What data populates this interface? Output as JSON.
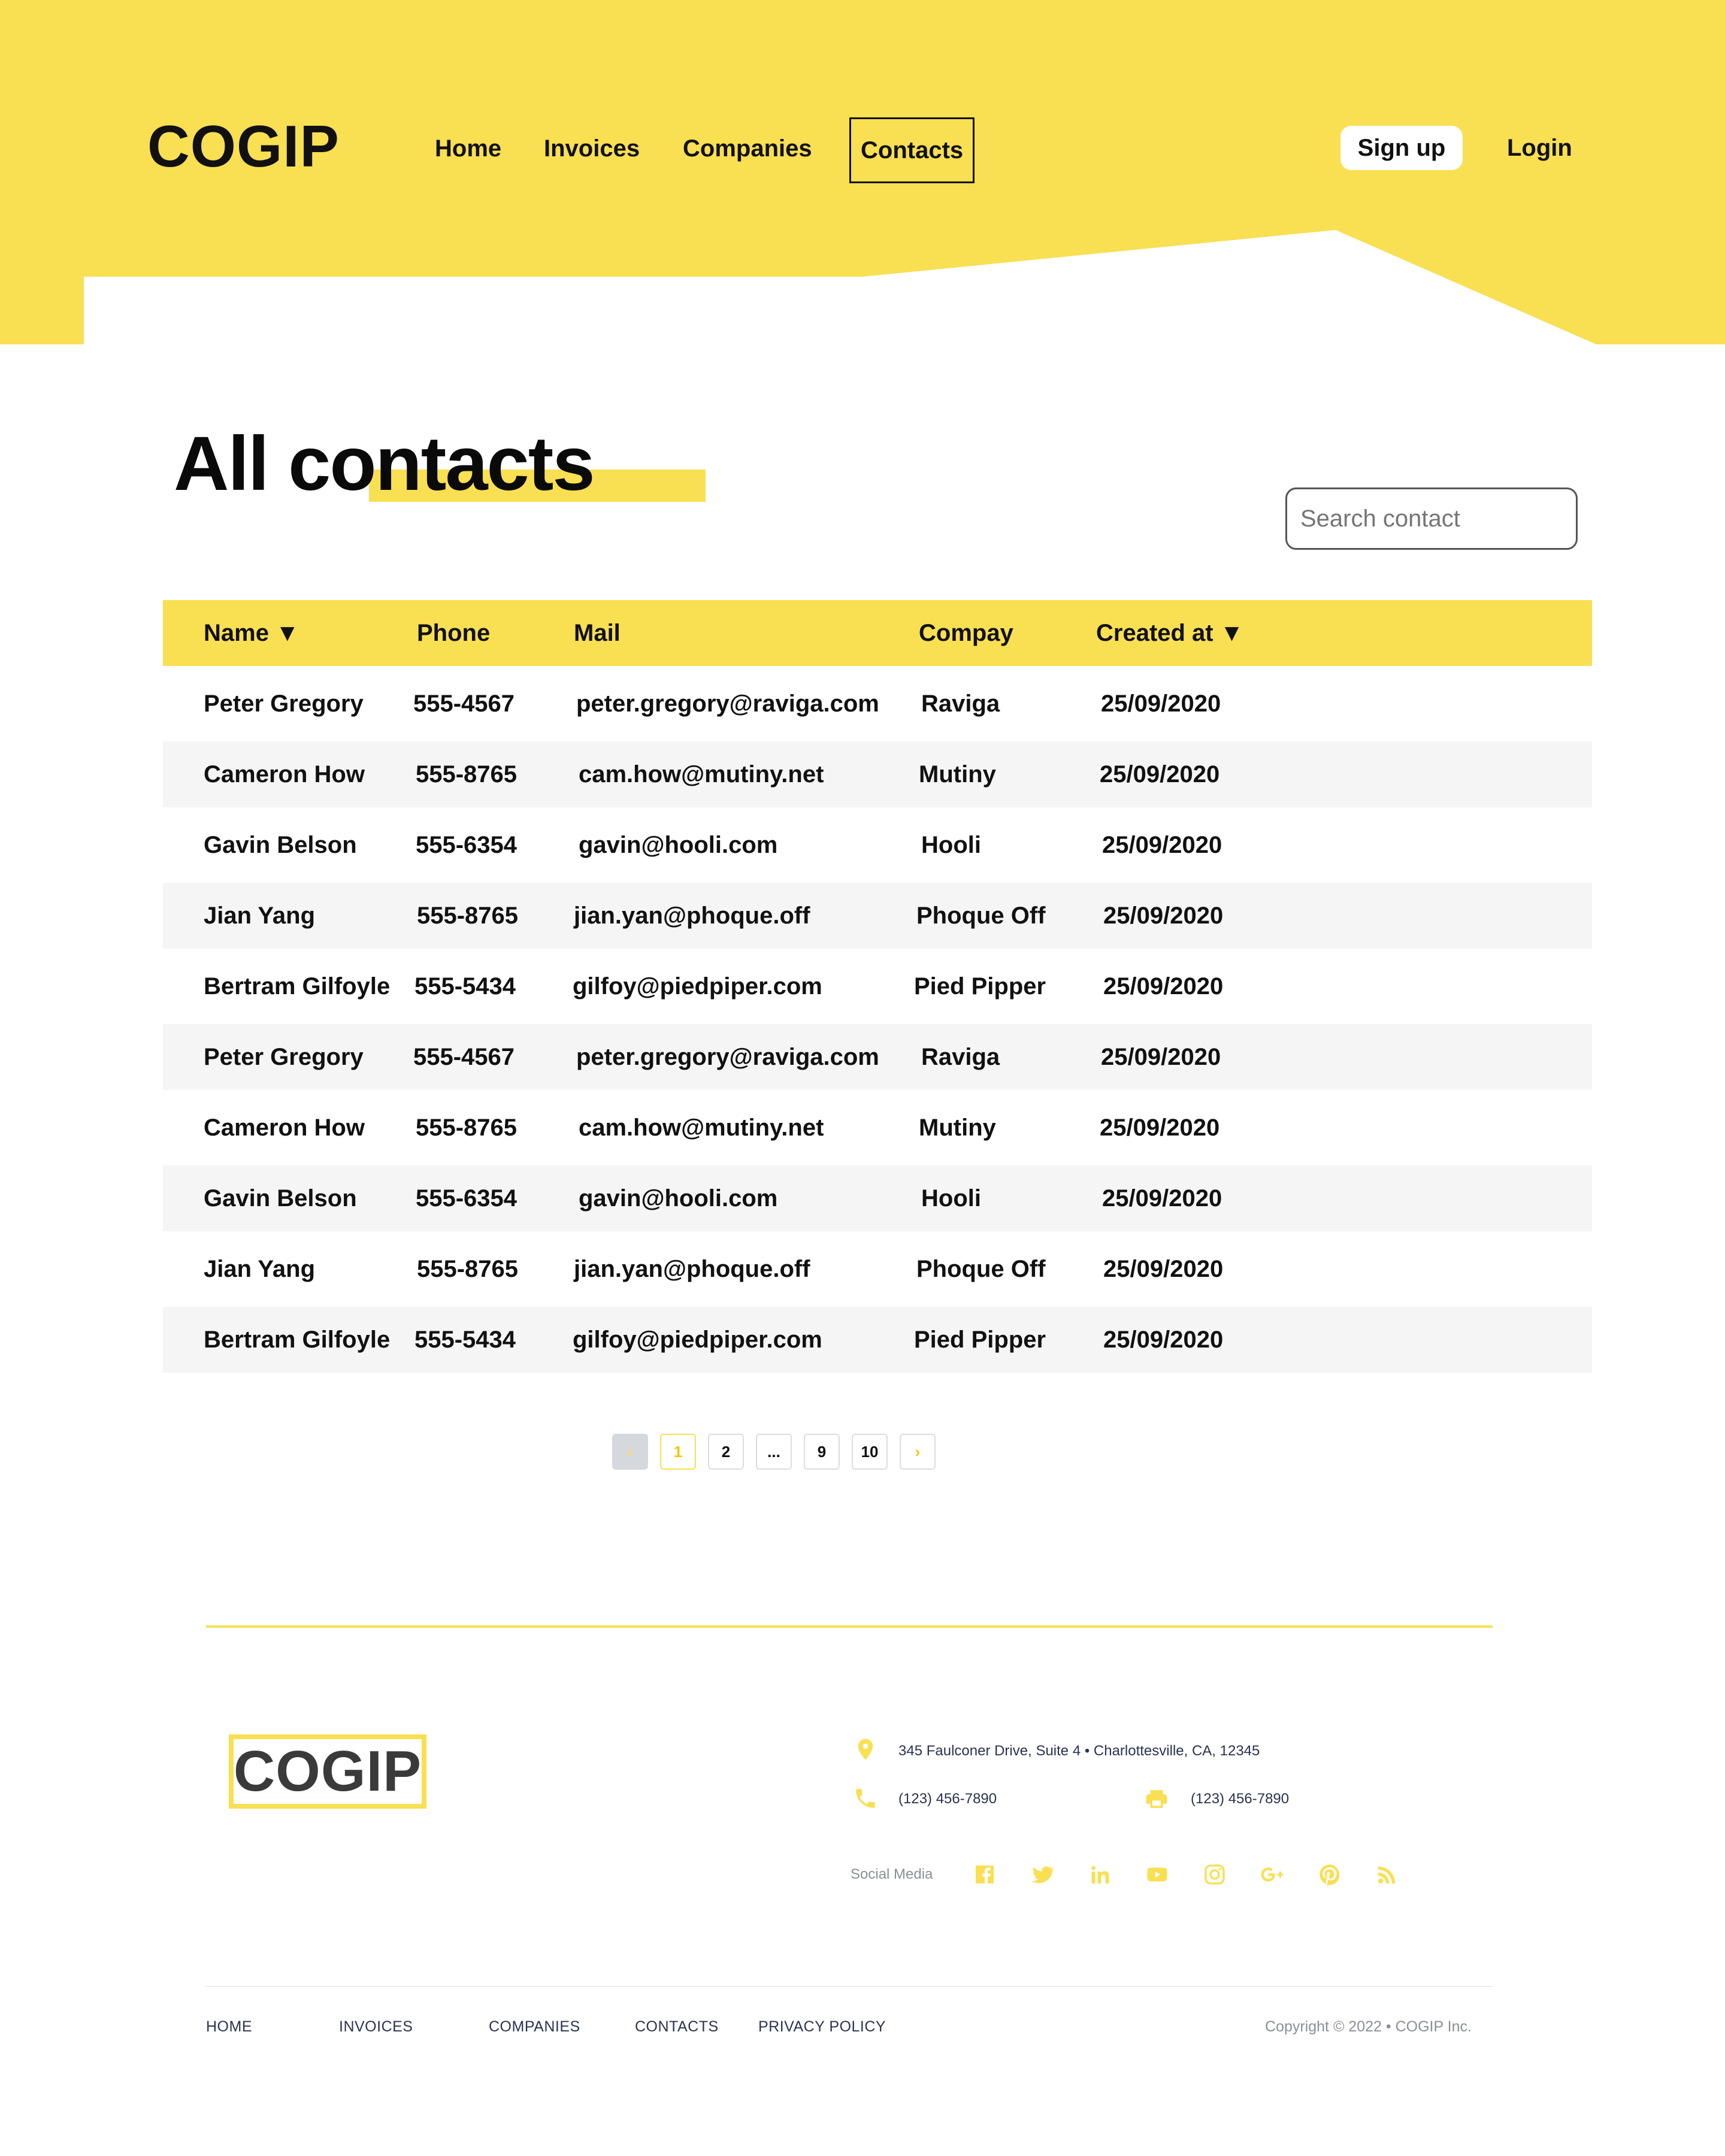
{
  "header": {
    "logo": "COGIP",
    "nav": [
      "Home",
      "Invoices",
      "Companies",
      "Contacts"
    ],
    "active_nav": "Contacts",
    "signup_label": "Sign up",
    "login_label": "Login"
  },
  "page": {
    "title": "All contacts",
    "search_placeholder": "Search contact"
  },
  "table": {
    "headers": [
      "Name ▼",
      "Phone",
      "Mail",
      "Compay",
      "Created at ▼"
    ],
    "rows": [
      [
        "Peter Gregory",
        "555-4567",
        "peter.gregory@raviga.com",
        "Raviga",
        "25/09/2020"
      ],
      [
        "Cameron How",
        "555-8765",
        "cam.how@mutiny.net",
        "Mutiny",
        "25/09/2020"
      ],
      [
        "Gavin Belson",
        "555-6354",
        "gavin@hooli.com",
        "Hooli",
        "25/09/2020"
      ],
      [
        "Jian Yang",
        "555-8765",
        "jian.yan@phoque.off",
        "Phoque Off",
        "25/09/2020"
      ],
      [
        "Bertram Gilfoyle",
        "555-5434",
        "gilfoy@piedpiper.com",
        "Pied Pipper",
        "25/09/2020"
      ],
      [
        "Peter Gregory",
        "555-4567",
        "peter.gregory@raviga.com",
        "Raviga",
        "25/09/2020"
      ],
      [
        "Cameron How",
        "555-8765",
        "cam.how@mutiny.net",
        "Mutiny",
        "25/09/2020"
      ],
      [
        "Gavin Belson",
        "555-6354",
        "gavin@hooli.com",
        "Hooli",
        "25/09/2020"
      ],
      [
        "Jian Yang",
        "555-8765",
        "jian.yan@phoque.off",
        "Phoque Off",
        "25/09/2020"
      ],
      [
        "Bertram Gilfoyle",
        "555-5434",
        "gilfoy@piedpiper.com",
        "Pied Pipper",
        "25/09/2020"
      ]
    ]
  },
  "pagination": {
    "prev": "‹",
    "pages": [
      "1",
      "2",
      "...",
      "9",
      "10"
    ],
    "current": "1",
    "next": "›"
  },
  "footer": {
    "logo": "COGIP",
    "address": "345 Faulconer Drive, Suite 4 • Charlottesville, CA, 12345",
    "phone": "(123) 456-7890",
    "fax": "(123) 456-7890",
    "social_label": "Social Media",
    "social_icons": [
      "facebook-icon",
      "twitter-icon",
      "linkedin-icon",
      "youtube-icon",
      "instagram-icon",
      "google-plus-icon",
      "pinterest-icon",
      "rss-icon"
    ],
    "links": [
      "HOME",
      "INVOICES",
      "COMPANIES",
      "CONTACTS",
      "PRIVACY POLICY"
    ],
    "copyright": "Copyright © 2022 • COGIP Inc."
  },
  "colors": {
    "accent": "#f9df52",
    "row_alt": "#f5f5f5",
    "text": "#111111"
  }
}
